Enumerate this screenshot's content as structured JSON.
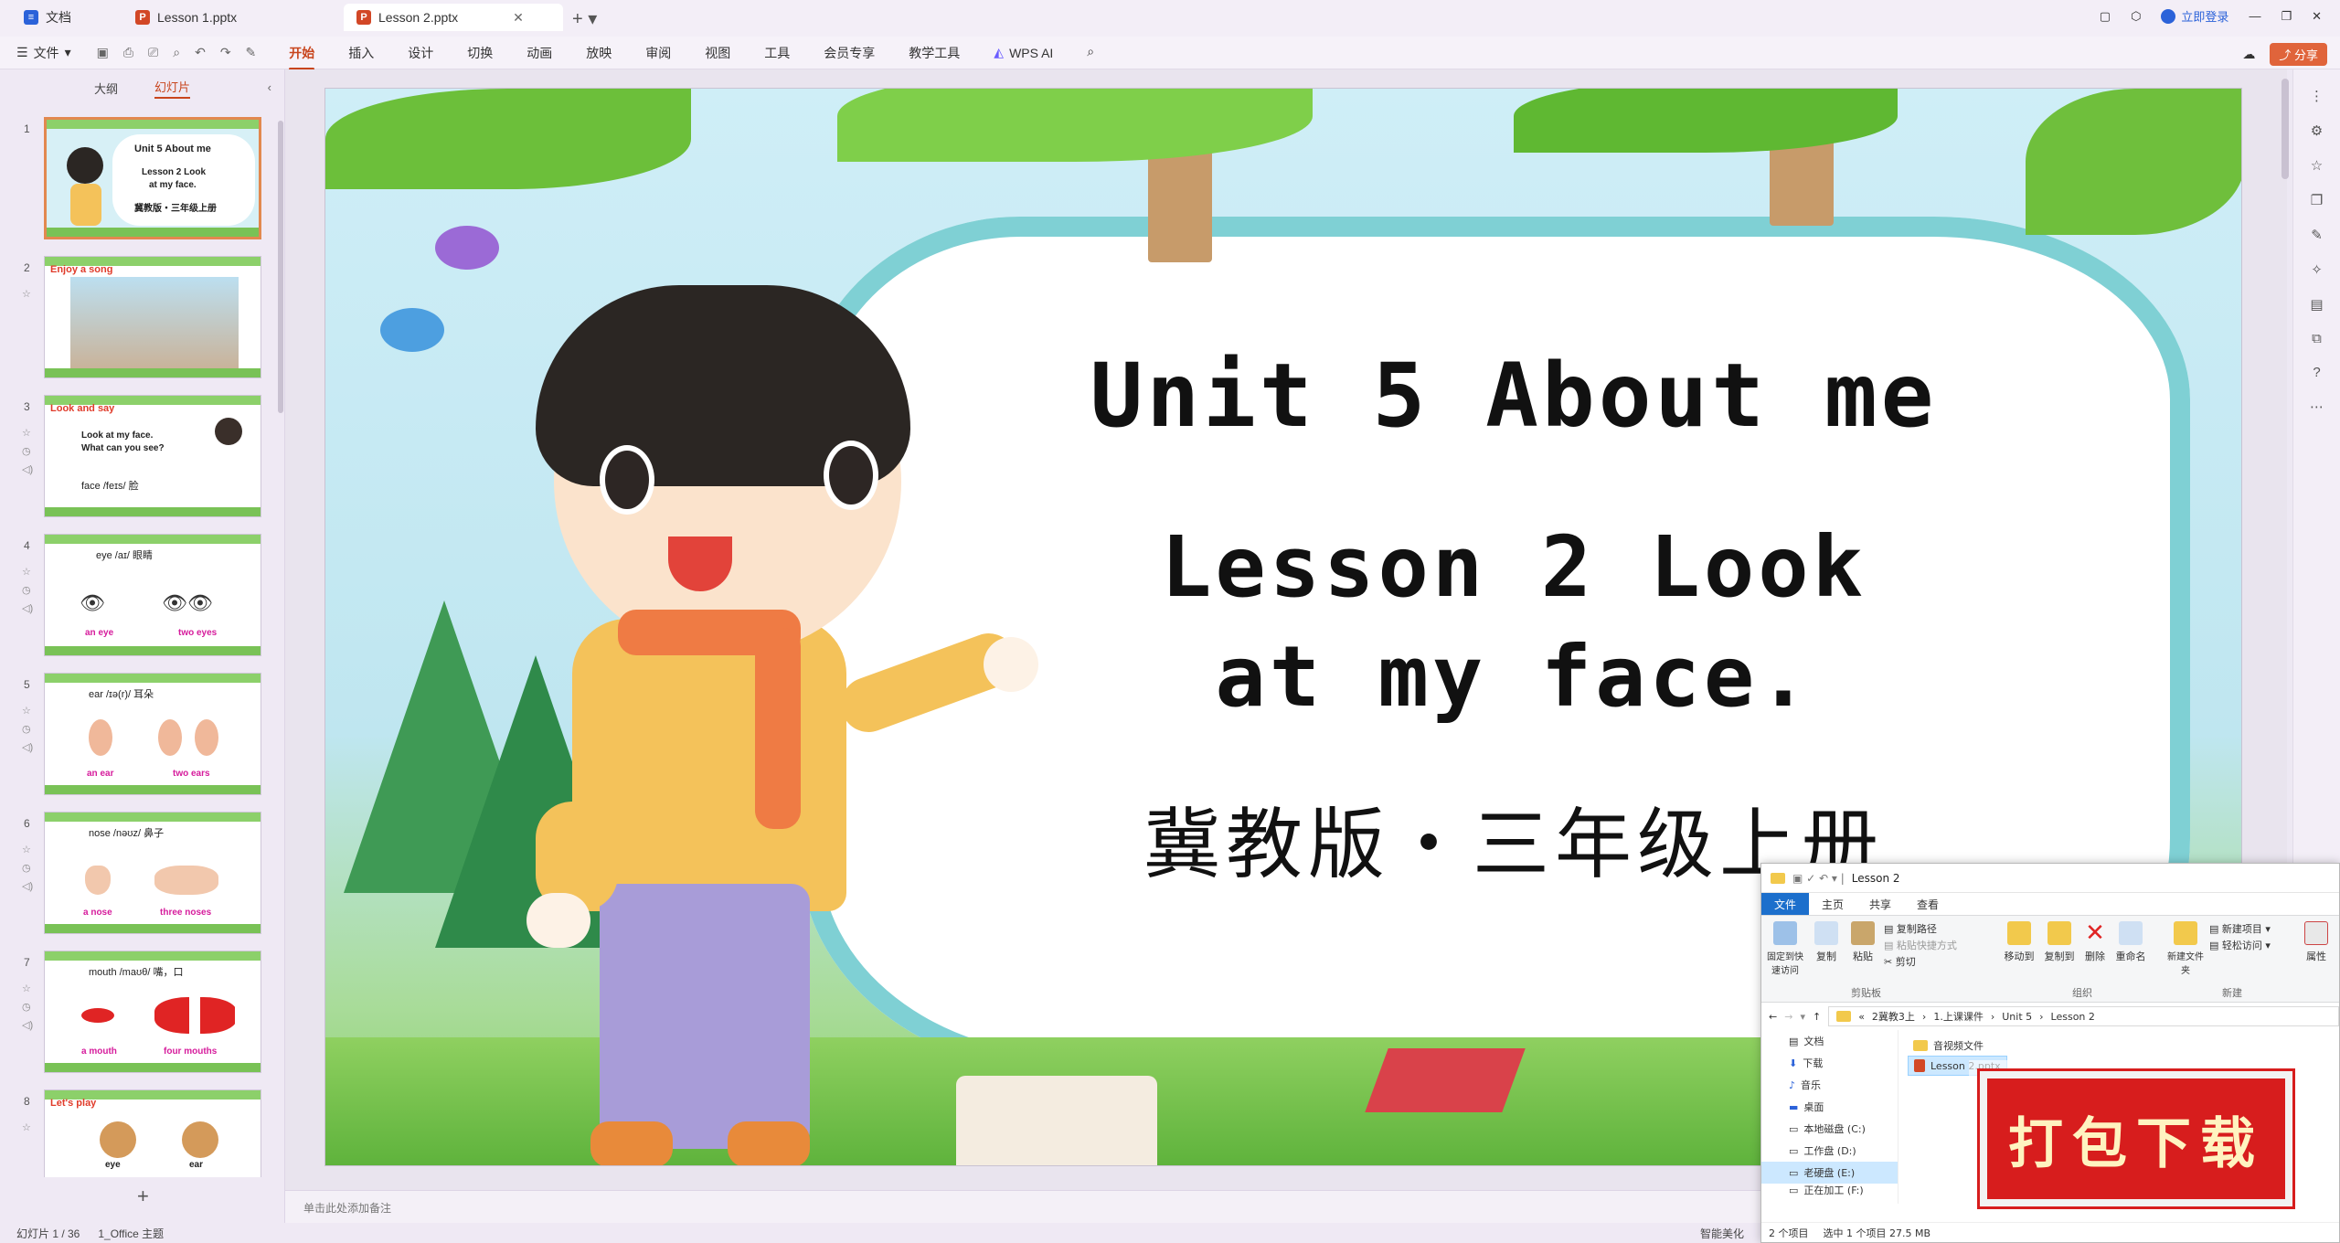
{
  "tabs": [
    {
      "label": "文档",
      "icon_color": "#2b62d9"
    },
    {
      "label": "Lesson 1.pptx",
      "icon_color": "#d24726"
    },
    {
      "label": "Lesson 2.pptx",
      "icon_color": "#d24726",
      "active": true
    }
  ],
  "titlebar": {
    "login": "立即登录"
  },
  "ribbon": {
    "file": "文件",
    "menus": [
      "开始",
      "插入",
      "设计",
      "切换",
      "动画",
      "放映",
      "审阅",
      "视图",
      "工具",
      "会员专享",
      "教学工具"
    ],
    "wps_ai": "WPS AI",
    "share": "分享"
  },
  "leftpanel": {
    "tab_outline": "大纲",
    "tab_slides": "幻灯片",
    "thumbs": [
      {
        "num": "1",
        "title": "Unit 5 About me",
        "sub1": "Lesson 2 Look",
        "sub2": "at my face.",
        "sub3": "冀教版・三年级上册"
      },
      {
        "num": "2",
        "title": "Enjoy a song"
      },
      {
        "num": "3",
        "title": "Look and say",
        "line1": "Look at my face.",
        "line2": "What can you see?",
        "line3": "face /feɪs/ 脸"
      },
      {
        "num": "4",
        "line1": "eye /aɪ/ 眼睛",
        "left": "an eye",
        "right": "two eyes"
      },
      {
        "num": "5",
        "line1": "ear /ɪə(r)/ 耳朵",
        "left": "an ear",
        "right": "two ears"
      },
      {
        "num": "6",
        "line1": "nose /nəʊz/ 鼻子",
        "left": "a nose",
        "right": "three noses"
      },
      {
        "num": "7",
        "line1": "mouth /maʊθ/ 嘴，口",
        "left": "a mouth",
        "right": "four mouths"
      },
      {
        "num": "8",
        "title": "Let's play",
        "left": "eye",
        "right": "ear"
      }
    ]
  },
  "slide": {
    "title": "Unit 5 About me",
    "line2": "Lesson 2 Look",
    "line3": "at my face.",
    "publisher": "冀教版・三年级上册"
  },
  "notes_placeholder": "单击此处添加备注",
  "status": {
    "slide_count": "幻灯片 1 / 36",
    "theme": "1_Office 主题",
    "beautify": "智能美化"
  },
  "explorer": {
    "title": "Lesson 2",
    "tabs": [
      "文件",
      "主页",
      "共享",
      "查看"
    ],
    "ribbon": {
      "pin": "固定到快速访问",
      "copy": "复制",
      "paste": "粘贴",
      "copy_path": "复制路径",
      "paste_shortcut": "粘贴快捷方式",
      "cut": "剪切",
      "clipboard": "剪贴板",
      "move_to": "移动到",
      "copy_to": "复制到",
      "delete": "删除",
      "rename": "重命名",
      "organize": "组织",
      "new_folder": "新建文件夹",
      "new_item": "新建项目",
      "easy_access": "轻松访问",
      "new": "新建",
      "properties": "属性"
    },
    "address": [
      "«",
      "2冀教3上",
      "1.上课课件",
      "Unit 5",
      "Lesson 2"
    ],
    "nav": [
      "文档",
      "下载",
      "音乐",
      "桌面",
      "本地磁盘 (C:)",
      "工作盘 (D:)",
      "老硬盘 (E:)",
      "正在加工 (F:)"
    ],
    "files": [
      "音视频文件",
      "Lesson 2.pptx"
    ],
    "status": [
      "2 个项目",
      "选中 1 个项目  27.5 MB"
    ]
  },
  "badge": "打包下载"
}
